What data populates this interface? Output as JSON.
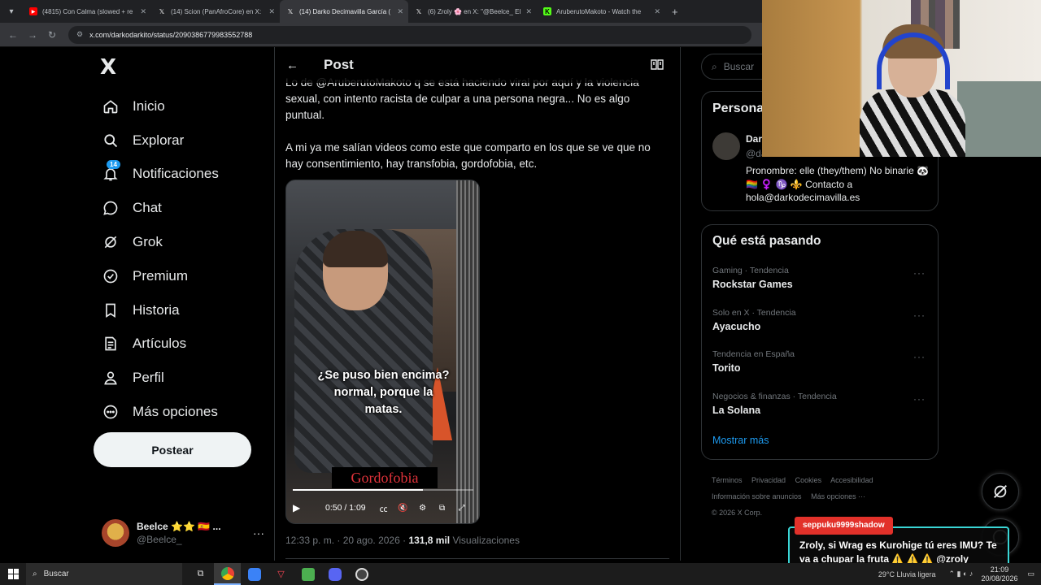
{
  "browser": {
    "tabs": [
      {
        "title": "(4815) Con Calma (slowed + re",
        "icon": "youtube-icon",
        "active": false
      },
      {
        "title": "(14) Scion (PanAfroCore) en X:",
        "icon": "x-icon",
        "active": false
      },
      {
        "title": "(14) Darko Decimavilla García (",
        "icon": "x-icon",
        "active": true
      },
      {
        "title": "(6) Zroly 🌸 en X: \"@Beelce_ El",
        "icon": "x-icon",
        "active": false
      },
      {
        "title": "AruberutoMakoto - Watch the",
        "icon": "kick-icon",
        "active": false
      }
    ],
    "new_tab": "+",
    "url": "x.com/darkodarkito/status/2090386779983552788"
  },
  "sidebar": {
    "logo": "X",
    "items": [
      {
        "label": "Inicio",
        "icon": "home-icon"
      },
      {
        "label": "Explorar",
        "icon": "search-icon"
      },
      {
        "label": "Notificaciones",
        "icon": "bell-icon",
        "badge": "14"
      },
      {
        "label": "Chat",
        "icon": "chat-icon"
      },
      {
        "label": "Grok",
        "icon": "grok-icon"
      },
      {
        "label": "Premium",
        "icon": "verified-icon"
      },
      {
        "label": "Historia",
        "icon": "bookmark-icon"
      },
      {
        "label": "Artículos",
        "icon": "articles-icon"
      },
      {
        "label": "Perfil",
        "icon": "person-icon"
      },
      {
        "label": "Más opciones",
        "icon": "more-circle-icon"
      }
    ],
    "post_button": "Postear",
    "account": {
      "name": "Beelce ⭐⭐ 🇪🇸 ...",
      "handle": "@Beelce_",
      "more": "···"
    }
  },
  "post": {
    "header_title": "Post",
    "paragraphs": [
      "Lo de @AruberutoMakoto q se está haciendo viral por aquí y la violencia sexual, con intento racista de culpar a una persona negra... No es algo puntual.",
      "A mi ya me salían videos como este que comparto en los que se ve que no hay consentimiento, hay transfobia, gordofobia, etc."
    ],
    "video": {
      "subtitle_line1": "¿Se puso bien encima?",
      "subtitle_line2": "normal, porque la",
      "subtitle_line3": "matas.",
      "tagline": "Gordofobia",
      "time": "0:50 / 1:09",
      "progress": 0.72
    },
    "timestamp": "12:33 p. m. · 20 ago. 2026 · ",
    "views_count": "131,8 mil",
    "views_label": " Visualizaciones"
  },
  "right": {
    "search_placeholder": "Buscar",
    "profile_card": {
      "title": "Persona",
      "name": "Dar",
      "handle": "@da",
      "bio": "Pronombre: elle (they/them) No binarie 🐼 🏳️‍🌈 ♀️ ♑ ⚜️ Contacto a hola@darkodecimavilla.es"
    },
    "trends_title": "Qué está pasando",
    "trends": [
      {
        "category": "Gaming · Tendencia",
        "name": "Rockstar Games"
      },
      {
        "category": "Solo en X · Tendencia",
        "name": "Ayacucho"
      },
      {
        "category": "Tendencia en España",
        "name": "Torito"
      },
      {
        "category": "Negocios & finanzas · Tendencia",
        "name": "La Solana"
      }
    ],
    "show_more": "Mostrar más",
    "footer": {
      "terms": "Términos",
      "privacy": "Privacidad",
      "cookies": "Cookies",
      "accessibility": "Accesibilidad",
      "ads_info": "Información sobre anuncios",
      "more": "Más opciones ···",
      "copyright": "© 2026 X Corp."
    }
  },
  "chat_overlay": {
    "user": "seppuku9999shadow",
    "message": "Zroly, si Wrag es Kurohige tú eres IMU? Te va a chupar la fruta ⚠️ ⚠️ ⚠️ @zroly"
  },
  "taskbar": {
    "search_label": "Buscar",
    "weather": "29°C  Lluvia ligera",
    "time": "21:09",
    "date": "20/08/2026"
  },
  "colors": {
    "accent": "#1d9bf0",
    "chat_border": "#3ad6d6",
    "chat_user_bg": "#e2312a"
  }
}
